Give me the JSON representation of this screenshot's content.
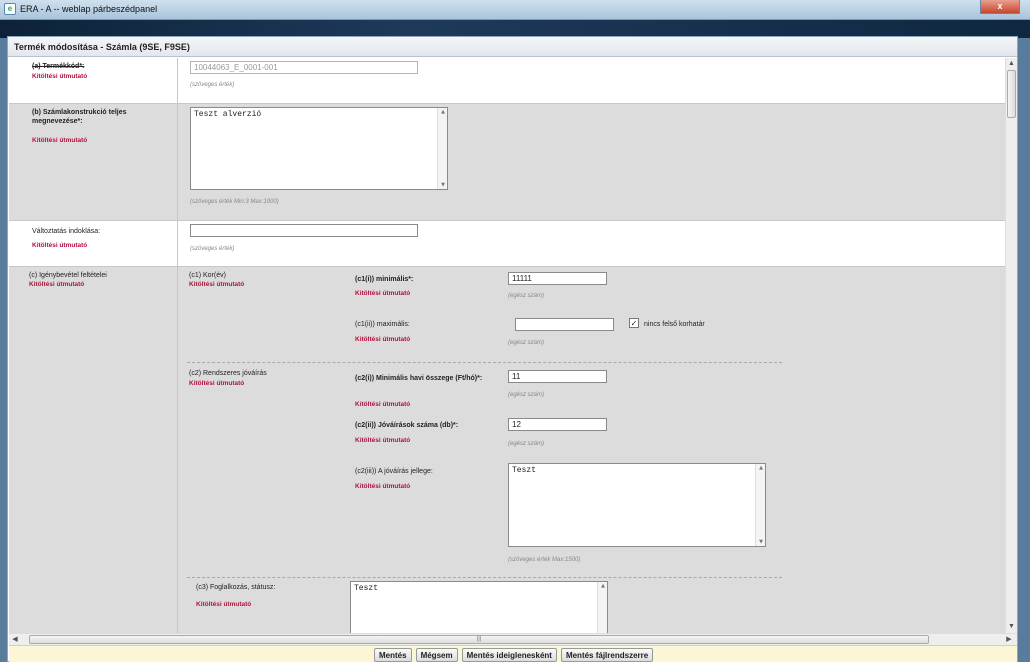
{
  "window": {
    "title": "ERA - A -- weblap párbeszédpanel",
    "close_label": "x"
  },
  "dialog": {
    "title": "Termék módosítása - Számla (9SE, F9SE)"
  },
  "guide_text": "Kitöltési útmutató",
  "fields": {
    "termekkod": {
      "label": "(a) Termékkód*:",
      "value": "10044063_E_0001-001",
      "hint": "(szöveges érték)"
    },
    "szamlakonstrukcio": {
      "label": "(b) Számlakonstrukció teljes megnevezése*:",
      "value": "Teszt alverzió",
      "hint": "(szöveges érték Min:3 Max:1000)"
    },
    "valtoztatas": {
      "label": "Változtatás indoklása:",
      "value": "",
      "hint": "(szöveges érték)"
    },
    "igenybevetel": {
      "label": "(c) Igénybevétel feltételei",
      "c1": {
        "label": "(c1) Kor(év)",
        "min_label": "(c1(i)) minimális*:",
        "min_value": "11111",
        "min_hint": "(egész szám)",
        "max_label": "(c1(ii)) maximális:",
        "max_value": "",
        "max_hint": "(egész szám)",
        "no_limit_label": "nincs felső korhatár",
        "no_limit_checked": "✓"
      },
      "c2": {
        "label": "(c2) Rendszeres jóváírás",
        "i_label": "(c2(i)) Minimális havi összege (Ft/hó)*:",
        "i_value": "11",
        "i_hint": "(egész szám)",
        "ii_label": "(c2(ii)) Jóváírások száma (db)*:",
        "ii_value": "12",
        "ii_hint": "(egész szám)",
        "iii_label": "(c2(iii)) A jóváírás jellege:",
        "iii_value": "Teszt",
        "iii_hint": "(szöveges érték Max:1500)"
      },
      "c3": {
        "label": "(c3) Foglalkozás, státusz:",
        "value": "Teszt"
      }
    }
  },
  "footer": {
    "save": "Mentés",
    "cancel": "Mégsem",
    "save_temp": "Mentés ideiglenesként",
    "save_file": "Mentés fájlrendszerre"
  },
  "scroll": {
    "h_thumb_grip": "|||"
  }
}
